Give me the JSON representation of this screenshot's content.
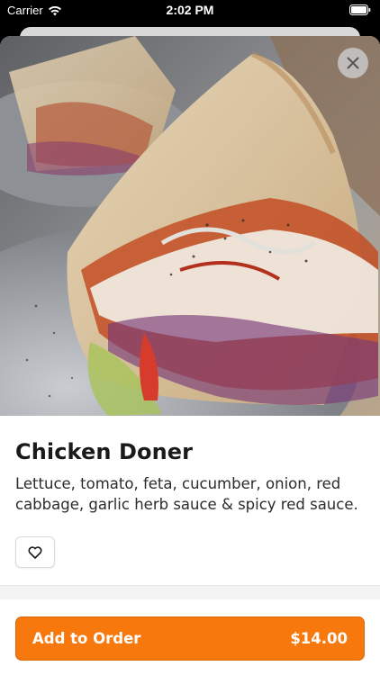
{
  "status_bar": {
    "carrier": "Carrier",
    "time": "2:02 PM",
    "wifi_icon": "wifi-icon",
    "battery_icon": "battery-icon"
  },
  "hero": {
    "image": "food-photo-chicken-doner",
    "close_icon": "close-icon"
  },
  "item": {
    "title": "Chicken Doner",
    "description": "Lettuce, tomato, feta, cucumber, onion, red cabbage, garlic herb sauce & spicy red sauce.",
    "favorite_icon": "heart-icon"
  },
  "order": {
    "button_label": "Add to Order",
    "price": "$14.00"
  },
  "colors": {
    "accent": "#f7790e",
    "text": "#1a1a1a"
  }
}
